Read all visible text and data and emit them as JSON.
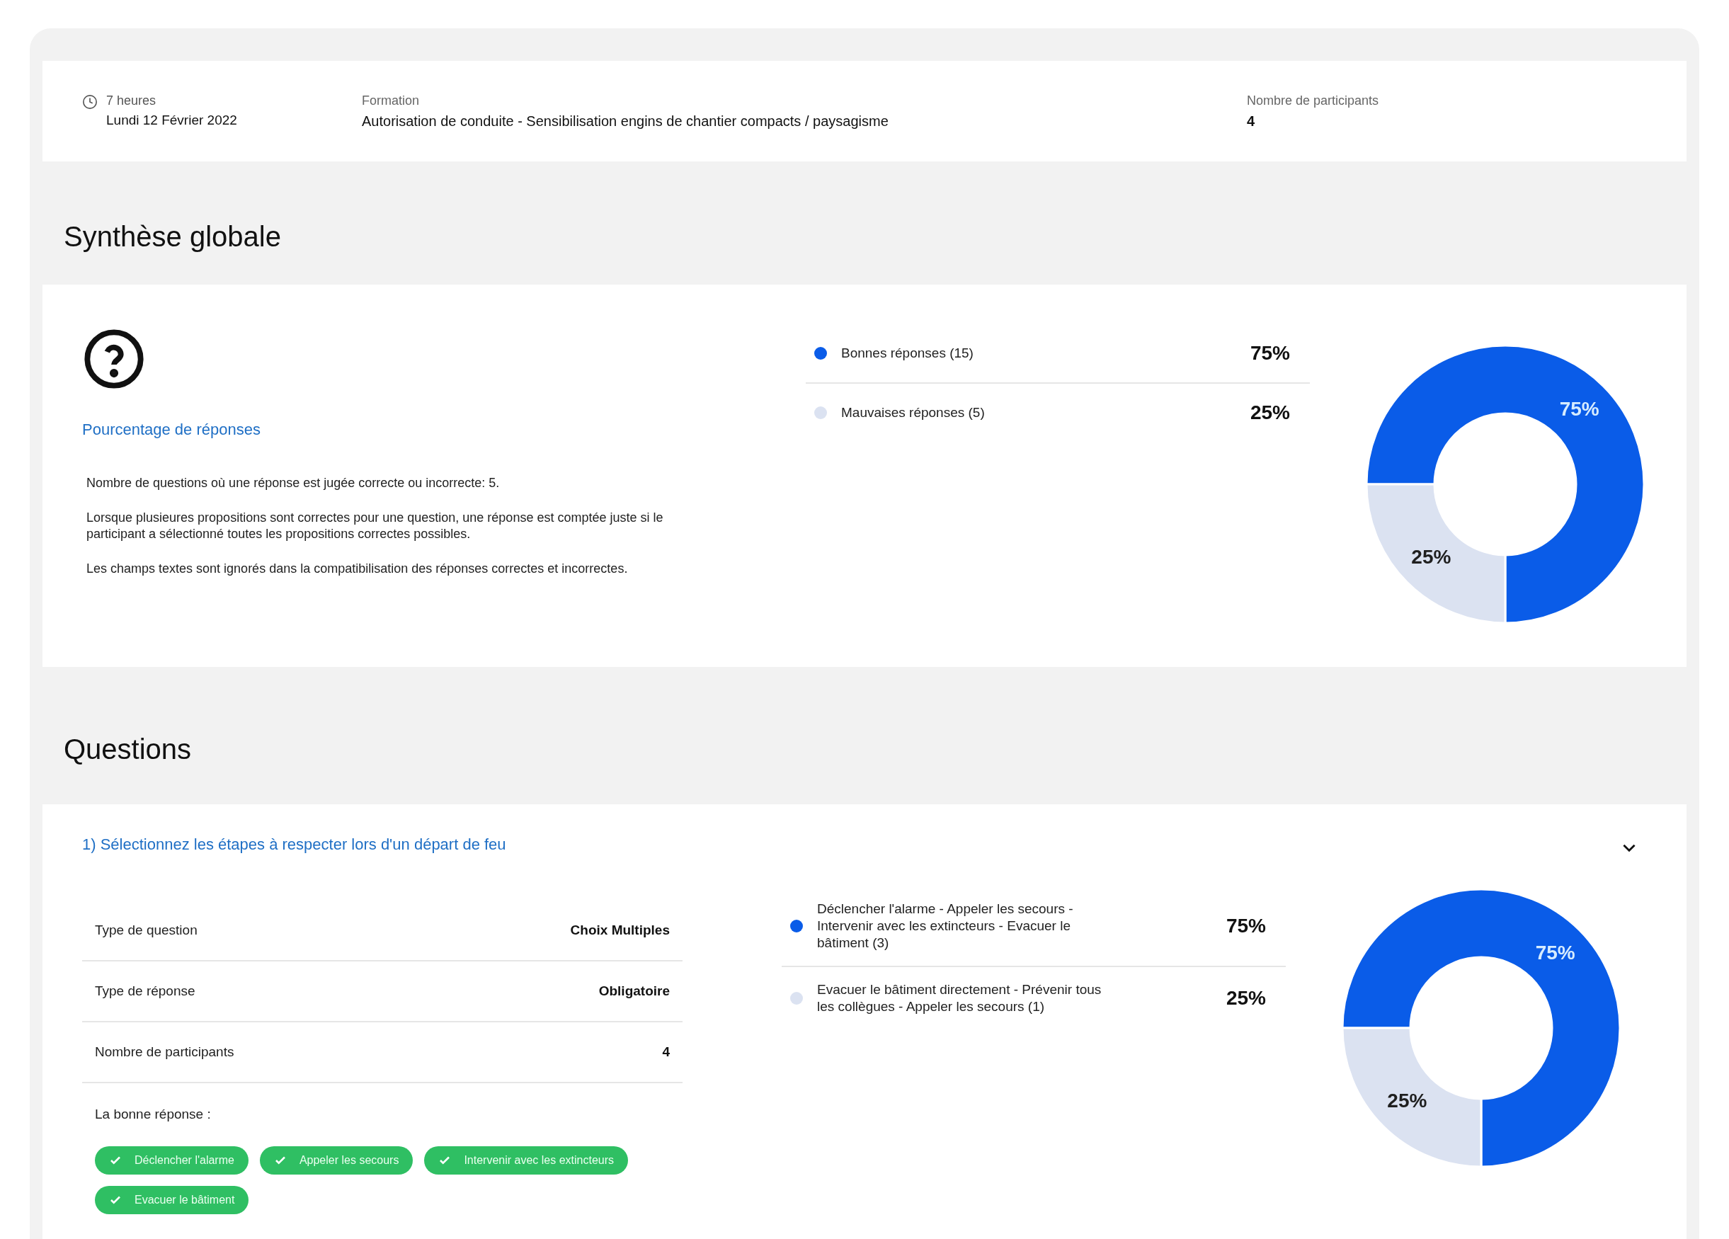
{
  "header": {
    "duration": "7 heures",
    "date": "Lundi 12 Février 2022",
    "formation_label": "Formation",
    "formation": "Autorisation de conduite - Sensibilisation engins de chantier compacts / paysagisme",
    "participants_label": "Nombre de participants",
    "participants": "4"
  },
  "summary": {
    "title": "Synthèse globale",
    "subtitle": "Pourcentage de réponses",
    "paragraphs": [
      "Nombre de questions où une réponse est jugée correcte ou incorrecte: 5.",
      "Lorsque plusieures propositions sont correctes pour une question, une réponse est comptée juste si le participant a sélectionné toutes les propositions correctes possibles.",
      "Les champs textes sont ignorés dans la compatibilisation des réponses correctes et incorrectes."
    ],
    "legend": [
      {
        "percent": "75%",
        "color": "#0a5ce8"
      },
      {
        "percent": "25%",
        "color": "#dbe2f1"
      }
    ],
    "chart_data": {
      "type": "donut",
      "categories": [
        "Bonnes réponses (15)",
        "Mauvaises réponses (5)"
      ],
      "values": [
        75,
        25
      ],
      "value_labels": [
        "75%",
        "25%"
      ]
    }
  },
  "questions_title": "Questions",
  "questions": [
    {
      "title": "1) Sélectionnez les étapes à respecter lors d'un départ de feu",
      "expanded": true,
      "details": [
        {
          "label": "Type de question",
          "value": "Choix Multiples"
        },
        {
          "label": "Type de réponse",
          "value": "Obligatoire"
        },
        {
          "label": "Nombre de participants",
          "value": "4"
        }
      ],
      "answer_label": "La bonne réponse :",
      "correct_answers": [
        "Déclencher l'alarme",
        "Appeler les secours",
        "Intervenir avec les extincteurs",
        "Evacuer le bâtiment"
      ],
      "legend": [
        {
          "percent": "75%",
          "color": "#0a5ce8"
        },
        {
          "percent": "25%",
          "color": "#dbe2f1"
        }
      ],
      "chart_data": {
        "type": "donut",
        "categories": [
          "Déclencher l'alarme - Appeler les secours - Intervenir avec les extincteurs - Evacuer le bâtiment (3)",
          "Evacuer le bâtiment directement - Prévenir tous les collègues - Appeler les secours (1)"
        ],
        "values": [
          75,
          25
        ],
        "value_labels": [
          "75%",
          "25%"
        ]
      }
    }
  ]
}
